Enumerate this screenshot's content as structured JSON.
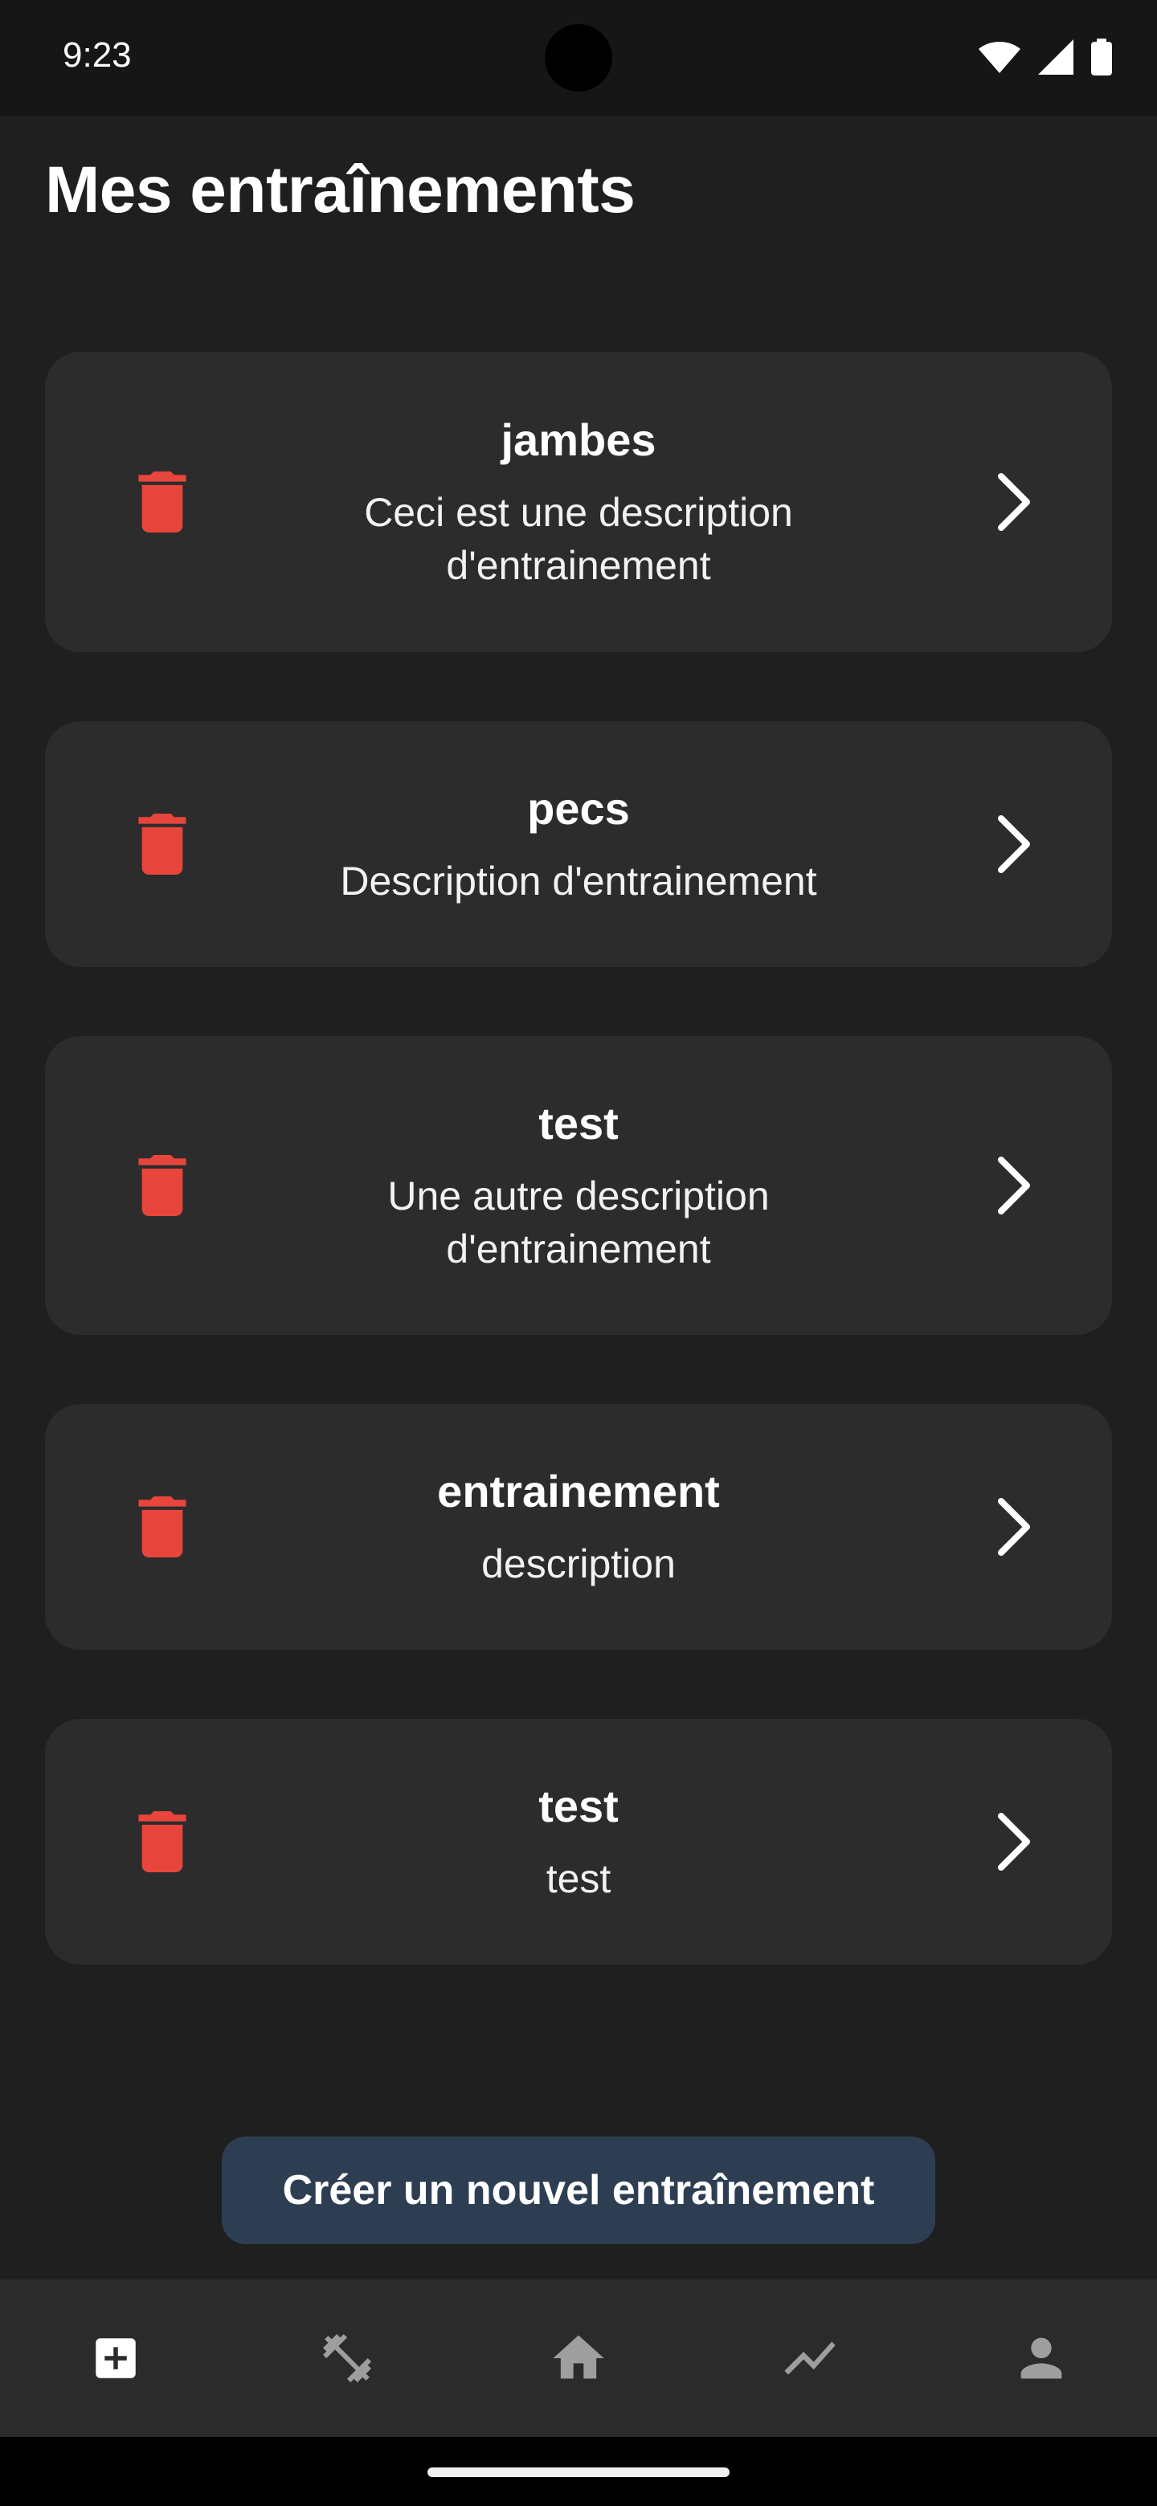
{
  "status_bar": {
    "time": "9:23",
    "icons": [
      "wifi-icon",
      "cell-signal-icon",
      "battery-icon"
    ]
  },
  "page": {
    "title": "Mes entraînements"
  },
  "workouts": [
    {
      "title": "jambes",
      "description_lines": [
        "Ceci est une description",
        "d'entrainement"
      ]
    },
    {
      "title": "pecs",
      "description_lines": [
        "Description d'entrainement"
      ]
    },
    {
      "title": "test",
      "description_lines": [
        "Une autre description",
        "d'entrainement"
      ]
    },
    {
      "title": "entrainement",
      "description_lines": [
        "description"
      ]
    },
    {
      "title": "test",
      "description_lines": [
        "test"
      ]
    }
  ],
  "actions": {
    "create_label": "Créer un nouvel entraînement"
  },
  "bottom_nav": {
    "items": [
      {
        "icon": "add-box-icon",
        "active": true
      },
      {
        "icon": "dumbbell-icon",
        "active": false
      },
      {
        "icon": "home-icon",
        "active": false
      },
      {
        "icon": "trending-icon",
        "active": false
      },
      {
        "icon": "person-icon",
        "active": false
      }
    ]
  },
  "colors": {
    "background": "#1f1f1f",
    "card": "#2c2c2c",
    "trash": "#e8453c",
    "button": "#2e3e52",
    "nav": "#2b2b2b",
    "nav_active": "#ffffff",
    "nav_inactive": "#9e9e9e"
  }
}
